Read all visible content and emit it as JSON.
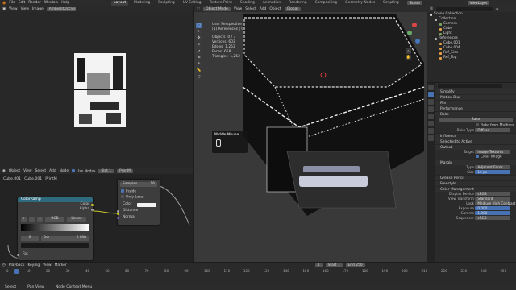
{
  "menu": [
    "File",
    "Edit",
    "Render",
    "Window",
    "Help"
  ],
  "workspaces": [
    "Layout",
    "Modeling",
    "Sculpting",
    "UV Editing",
    "Texture Paint",
    "Shading",
    "Animation",
    "Rendering",
    "Compositing",
    "Geometry Nodes",
    "Scripting"
  ],
  "active_workspace": "Layout",
  "scene": "Scene",
  "view_layer": "ViewLayer",
  "image_editor": {
    "menus": [
      "View",
      "View",
      "Image"
    ],
    "image_name": "AmbientOcclusion"
  },
  "viewport": {
    "menus": [
      "Object Mode",
      "View",
      "Select",
      "Add",
      "Object"
    ],
    "transform": "Global",
    "overlay_lines": [
      "User Perspective",
      "(1) References | Cube.001"
    ],
    "stats": [
      {
        "k": "Objects",
        "v": "0 / 7"
      },
      {
        "k": "Vertices",
        "v": "603"
      },
      {
        "k": "Edges",
        "v": "1,253"
      },
      {
        "k": "Faces",
        "v": "658"
      },
      {
        "k": "Triangles",
        "v": "1,252"
      }
    ],
    "tooltip": "Middle Mouse"
  },
  "node_editor": {
    "menus": [
      "Object",
      "View",
      "Select",
      "Add",
      "Node"
    ],
    "use_nodes": "Use Nodes",
    "slot": "Slot 1",
    "material": "PrintM",
    "breadcrumb": [
      "Cube.001",
      "Cube.001",
      "PrintM"
    ],
    "colorramp": {
      "title": "ColorRamp",
      "out1": "Color",
      "out2": "Alpha",
      "mode": "RGB",
      "interp": "Linear",
      "stop_index": "0",
      "pos_label": "Pos",
      "pos_value": "0.000",
      "fac": "Fac"
    },
    "ao": {
      "samples_label": "Samples",
      "samples": "16",
      "inside": "Inside",
      "only_local": "Only Local",
      "color": "Color",
      "distance": "Distance",
      "normal": "Normal"
    }
  },
  "outliner": {
    "title": "Scene Collection",
    "items": [
      {
        "name": "Collection",
        "indent": 1,
        "color": "#b8b8b8"
      },
      {
        "name": "Camera",
        "indent": 2,
        "color": "#7aa45e"
      },
      {
        "name": "Cube",
        "indent": 2,
        "color": "#e3a046"
      },
      {
        "name": "Light",
        "indent": 2,
        "color": "#7aa45e"
      },
      {
        "name": "References",
        "indent": 1,
        "color": "#b8b8b8"
      },
      {
        "name": "Cube.001",
        "indent": 2,
        "color": "#e3a046"
      },
      {
        "name": "Cube.004",
        "indent": 2,
        "color": "#e3a046"
      },
      {
        "name": "Ref_Side",
        "indent": 2,
        "color": "#e3a046"
      },
      {
        "name": "Ref_Top",
        "indent": 2,
        "color": "#e3a046"
      }
    ]
  },
  "properties": {
    "sections": [
      "Simplify",
      "Motion Blur",
      "Film",
      "Performance",
      "Bake"
    ],
    "bake_button": "Bake",
    "from_multires": "Bake from Multires",
    "bake_type_label": "Bake Type",
    "bake_type": "Diffuse",
    "influence": "Influence",
    "selected_to_active": "Selected to Active",
    "output": "Output",
    "target_label": "Target",
    "target": "Image Textures",
    "clear_image": "Clear Image",
    "margin": "Margin",
    "margin_type_label": "Type",
    "margin_type": "Adjacent Faces",
    "size_label": "Size",
    "size": "16 px",
    "grease_pencil": "Grease Pencil",
    "freestyle": "Freestyle",
    "color_management": "Color Management",
    "display_device_label": "Display Device",
    "display_device": "sRGB",
    "view_transform_label": "View Transform",
    "view_transform": "Standard",
    "look_label": "Look",
    "look": "Medium High Contrast",
    "exposure_label": "Exposure",
    "exposure": "0.000",
    "gamma_label": "Gamma",
    "gamma": "1.000",
    "sequencer_label": "Sequencer",
    "sequencer": "sRGB"
  },
  "timeline": {
    "menus": [
      "Playback",
      "Keying",
      "View",
      "Marker"
    ],
    "frame": "1",
    "start_label": "Start",
    "start": "1",
    "end_label": "End",
    "end": "250",
    "ticks": [
      "0",
      "10",
      "20",
      "30",
      "40",
      "50",
      "60",
      "70",
      "80",
      "90",
      "100",
      "110",
      "120",
      "130",
      "140",
      "150",
      "160",
      "170",
      "180",
      "190",
      "200",
      "210",
      "220",
      "230",
      "240",
      "250"
    ]
  },
  "statusbar": [
    "Select",
    "Pan View",
    "Node Context Menu"
  ]
}
